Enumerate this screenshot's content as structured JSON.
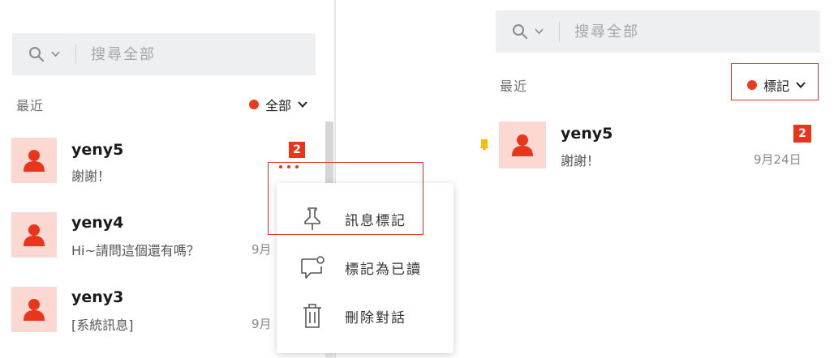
{
  "left": {
    "search": {
      "placeholder": "搜尋全部"
    },
    "section_label": "最近",
    "filter_label": "全部",
    "conversations": [
      {
        "name": "yeny5",
        "message": "謝謝！",
        "time": "",
        "unread": "2"
      },
      {
        "name": "yeny4",
        "message": "Hi~請問這個還有嗎？",
        "time": "9月"
      },
      {
        "name": "yeny3",
        "message": "[系統訊息]",
        "time": "9月"
      }
    ],
    "context_menu": {
      "items": [
        {
          "label": "訊息標記",
          "icon": "pin-icon"
        },
        {
          "label": "標記為已讀",
          "icon": "message-read-icon"
        },
        {
          "label": "刪除對話",
          "icon": "trash-icon"
        }
      ]
    }
  },
  "right": {
    "search": {
      "placeholder": "搜尋全部"
    },
    "section_label": "最近",
    "filter_label": "標記",
    "conversations": [
      {
        "name": "yeny5",
        "message": "謝謝！",
        "time": "9月24日",
        "unread": "2"
      }
    ]
  },
  "colors": {
    "accent": "#e8361c",
    "avatar_bg": "#fcd8d2",
    "search_bg": "#eeeff0",
    "highlight_border": "#d9382a",
    "pin_marker": "#f2c200"
  }
}
